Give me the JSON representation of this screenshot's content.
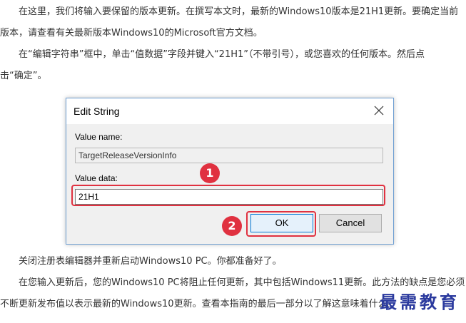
{
  "article": {
    "p1": {
      "line1": "在这里，我们将输入要保留的版本更新。在撰写本文时，最新的Windows10版本是21H1更新。要确定当前",
      "line2": "版本，请查看有关最新版本Windows10的Microsoft官方文档。"
    },
    "p2": {
      "line1": "在“编辑字符串”框中，单击“值数据”字段并键入“21H1”（不带引号），或您喜欢的任何版本。然后点",
      "line2": "击“确定”。"
    },
    "p3": {
      "line1": "关闭注册表编辑器并重新启动Windows10 PC。你都准备好了。"
    },
    "p4": {
      "line1": "在您输入更新后，您的Windows10 PC将阻止任何更新，其中包括Windows11更新。此方法的缺点是您必须",
      "line2": "不断更新发布值以表示最新的Windows10更新。查看本指南的最后一部分以了解这意味着什么。"
    }
  },
  "dialog": {
    "title": "Edit String",
    "value_name_label": "Value name:",
    "value_name": "TargetReleaseVersionInfo",
    "value_data_label": "Value data:",
    "value_data": "21H1",
    "ok_label": "OK",
    "cancel_label": "Cancel"
  },
  "annotations": {
    "step1": "1",
    "step2": "2",
    "highlight_color": "#e03140"
  },
  "watermark": "最需教育"
}
